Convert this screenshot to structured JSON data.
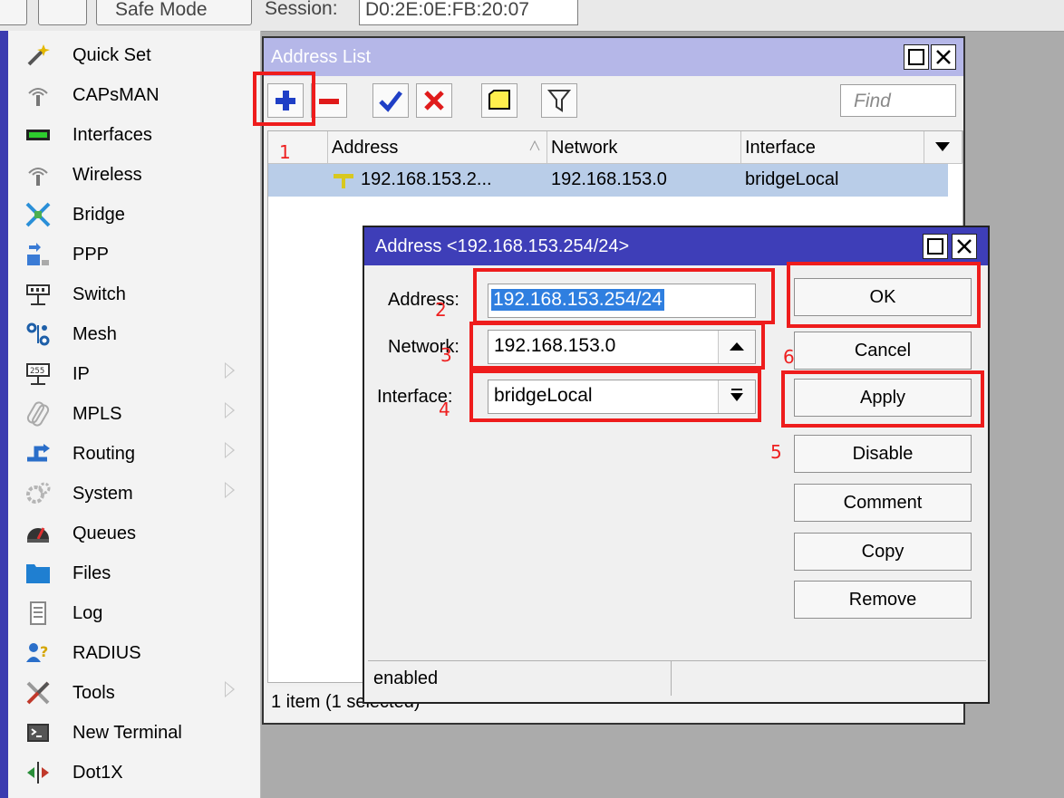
{
  "topbar": {
    "mode_label": "Safe Mode",
    "session_label": "Session:",
    "session_value": "D0:2E:0E:FB:20:07"
  },
  "sidebar": {
    "items": [
      {
        "label": "Quick Set",
        "icon": "wand-icon"
      },
      {
        "label": "CAPsMAN",
        "icon": "antenna-icon"
      },
      {
        "label": "Interfaces",
        "icon": "interfaces-icon"
      },
      {
        "label": "Wireless",
        "icon": "wireless-icon"
      },
      {
        "label": "Bridge",
        "icon": "bridge-icon"
      },
      {
        "label": "PPP",
        "icon": "ppp-icon"
      },
      {
        "label": "Switch",
        "icon": "switch-icon"
      },
      {
        "label": "Mesh",
        "icon": "mesh-icon"
      },
      {
        "label": "IP",
        "icon": "ip-icon",
        "submenu": true
      },
      {
        "label": "MPLS",
        "icon": "mpls-icon",
        "submenu": true
      },
      {
        "label": "Routing",
        "icon": "routing-icon",
        "submenu": true
      },
      {
        "label": "System",
        "icon": "gear-icon",
        "submenu": true
      },
      {
        "label": "Queues",
        "icon": "queues-icon"
      },
      {
        "label": "Files",
        "icon": "folder-icon"
      },
      {
        "label": "Log",
        "icon": "log-icon"
      },
      {
        "label": "RADIUS",
        "icon": "radius-icon"
      },
      {
        "label": "Tools",
        "icon": "tools-icon",
        "submenu": true
      },
      {
        "label": "New Terminal",
        "icon": "terminal-icon"
      },
      {
        "label": "Dot1X",
        "icon": "dot1x-icon"
      }
    ]
  },
  "address_list": {
    "title": "Address List",
    "find_placeholder": "Find",
    "columns": [
      "Address",
      "Network",
      "Interface"
    ],
    "rows": [
      {
        "address": "192.168.153.2...",
        "network": "192.168.153.0",
        "interface": "bridgeLocal"
      }
    ],
    "status": "1 item (1 selected)"
  },
  "dialog": {
    "title": "Address <192.168.153.254/24>",
    "address_label": "Address:",
    "address_value": "192.168.153.254/24",
    "network_label": "Network:",
    "network_value": "192.168.153.0",
    "interface_label": "Interface:",
    "interface_value": "bridgeLocal",
    "buttons": {
      "ok": "OK",
      "cancel": "Cancel",
      "apply": "Apply",
      "disable": "Disable",
      "comment": "Comment",
      "copy": "Copy",
      "remove": "Remove"
    },
    "status": "enabled"
  },
  "annotations": [
    "1",
    "2",
    "3",
    "4",
    "5",
    "6"
  ],
  "colors": {
    "highlight": "#ee1c1c",
    "dialog_title": "#3e3eb8",
    "list_title": "#b5b7e8",
    "selection": "#b9cde8",
    "sidebar_stripe": "#3b3bb0"
  }
}
